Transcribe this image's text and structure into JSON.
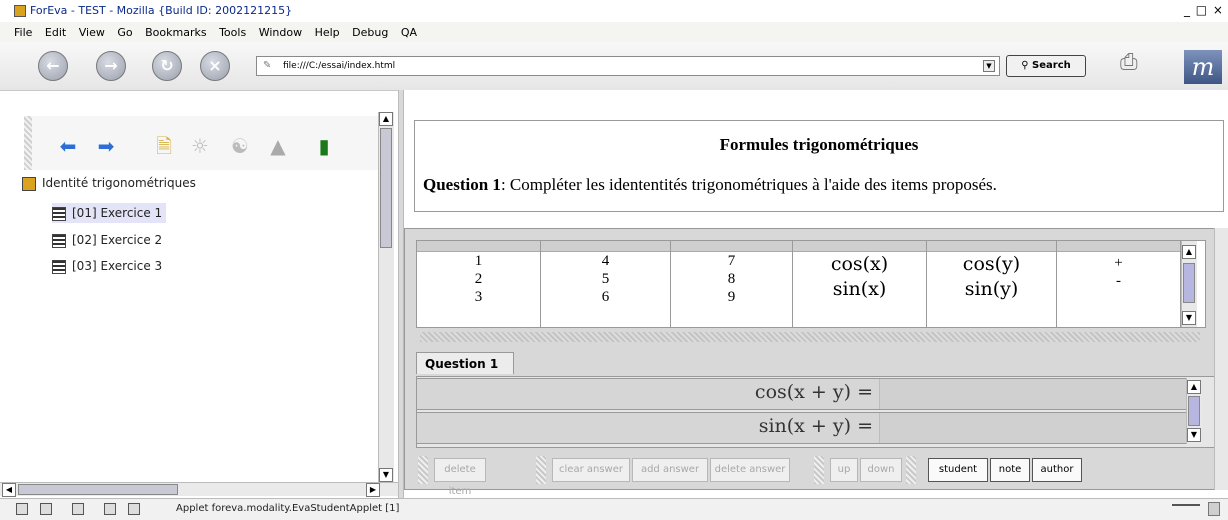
{
  "window": {
    "title": "ForEva - TEST - Mozilla {Build ID: 2002121215}",
    "controls": "_ □ ×"
  },
  "menu": [
    "File",
    "Edit",
    "View",
    "Go",
    "Bookmarks",
    "Tools",
    "Window",
    "Help",
    "Debug",
    "QA"
  ],
  "nav": {
    "url": "file:///C:/essai/index.html",
    "search_label": "Search"
  },
  "tree": {
    "root": "Identité trigonométriques",
    "items": [
      "[01] Exercice 1",
      "[02] Exercice 2",
      "[03] Exercice 3"
    ],
    "selected_index": 0
  },
  "content": {
    "title": "Formules trigonométriques",
    "question_label": "Question 1",
    "question_text": ": Compléter les idententités trigonométriques à l'aide des items proposés."
  },
  "items_grid": {
    "columns": [
      [
        "1",
        "2",
        "3"
      ],
      [
        "4",
        "5",
        "6"
      ],
      [
        "7",
        "8",
        "9"
      ],
      [
        "cos(x)",
        "sin(x)"
      ],
      [
        "cos(y)",
        "sin(y)"
      ],
      [
        "+",
        "-"
      ]
    ]
  },
  "tabs": [
    "Question 1"
  ],
  "answers": [
    {
      "lhs": "cos(x + y) ="
    },
    {
      "lhs": "sin(x + y) ="
    }
  ],
  "buttons": {
    "delete_item": "delete item",
    "clear_answer": "clear answer",
    "add_answer": "add answer",
    "delete_answer": "delete answer",
    "up": "up",
    "down": "down",
    "student": "student",
    "note": "note",
    "author": "author"
  },
  "status": {
    "text": "Applet foreva.modality.EvaStudentApplet [1]"
  }
}
